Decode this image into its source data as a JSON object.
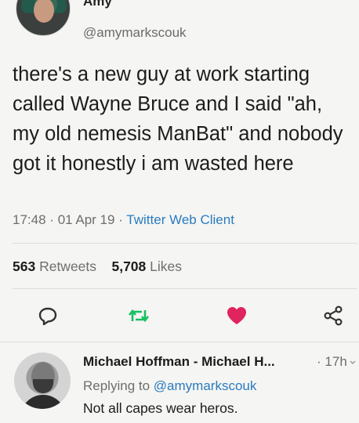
{
  "tweet": {
    "display_name": "Amy",
    "handle": "@amymarkscouk",
    "text": "there's a new guy at work starting called Wayne Bruce and I said \"ah, my old nemesis ManBat\" and nobody got it honestly i am wasted here",
    "time": "17:48",
    "date": "01 Apr 19",
    "source": "Twitter Web Client",
    "separator": "·"
  },
  "stats": {
    "retweets_count": "563",
    "retweets_label": "Retweets",
    "likes_count": "5,708",
    "likes_label": "Likes"
  },
  "actions": [
    {
      "icon": "reply-icon"
    },
    {
      "icon": "retweet-icon",
      "color": "#17bf63"
    },
    {
      "icon": "heart-icon",
      "color": "#e0245e"
    },
    {
      "icon": "share-icon"
    }
  ],
  "reply": {
    "name": "Michael Hoffman - Michael H...",
    "separator": "·",
    "time": "17h",
    "replying_prefix": "Replying to",
    "replying_handle": "@amymarkscouk",
    "text": "Not all capes wear heros."
  },
  "colors": {
    "link": "#2a7bbf",
    "background": "#f5f5f3"
  }
}
